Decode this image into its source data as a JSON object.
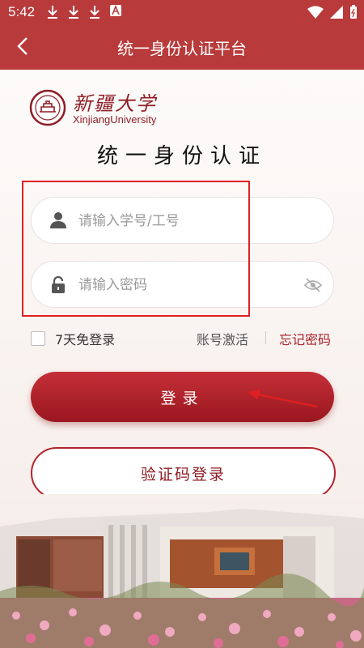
{
  "status_bar": {
    "time": "5:42",
    "icons": [
      "download-icon",
      "download-icon",
      "download-icon",
      "a-icon",
      "wifi-icon",
      "signal-icon",
      "battery-icon"
    ]
  },
  "app_bar": {
    "title": "统一身份认证平台",
    "back_icon": "back-chevron-icon"
  },
  "logo": {
    "cn_name": "新疆大学",
    "en_name": "XinjiangUniversity"
  },
  "heading": "统一身份认证",
  "form": {
    "username": {
      "placeholder": "请输入学号/工号",
      "value": "",
      "icon": "user-icon"
    },
    "password": {
      "placeholder": "请输入密码",
      "value": "",
      "icon": "lock-icon",
      "toggle_icon": "eye-off-icon"
    },
    "remember_label": "7天免登录",
    "activate_link": "账号激活",
    "forgot_link": "忘记密码"
  },
  "buttons": {
    "login": "登录",
    "code_login": "验证码登录"
  },
  "colors": {
    "primary": "#b83a3a",
    "accent": "#a8212a",
    "highlight": "#e02020"
  }
}
